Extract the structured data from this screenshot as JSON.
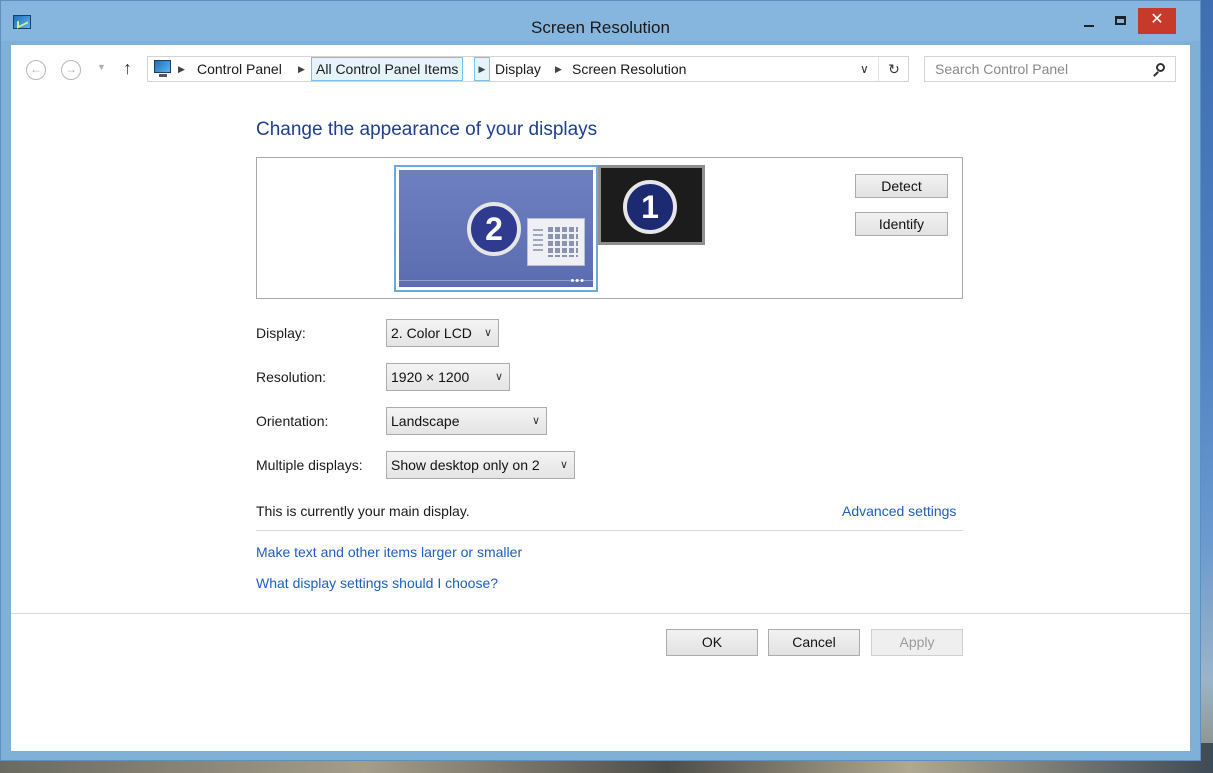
{
  "window": {
    "title": "Screen Resolution",
    "close_glyph": "✕"
  },
  "nav": {
    "breadcrumbs": [
      "Control Panel",
      "All Control Panel Items",
      "Display",
      "Screen Resolution"
    ],
    "search_placeholder": "Search Control Panel",
    "icons": [
      "back-icon",
      "forward-icon",
      "recent-locations-icon",
      "up-icon",
      "control-panel-icon",
      "address-dropdown-icon",
      "refresh-icon",
      "search-icon"
    ]
  },
  "main": {
    "heading": "Change the appearance of your displays",
    "monitors": [
      {
        "number": "2",
        "selected": true
      },
      {
        "number": "1",
        "selected": false
      }
    ],
    "detect_label": "Detect",
    "identify_label": "Identify",
    "fields": {
      "display": {
        "label": "Display:",
        "value": "2. Color LCD"
      },
      "resolution": {
        "label": "Resolution:",
        "value": "1920 × 1200"
      },
      "orientation": {
        "label": "Orientation:",
        "value": "Landscape"
      },
      "multiple": {
        "label": "Multiple displays:",
        "value": "Show desktop only on 2"
      }
    },
    "main_display_text": "This is currently your main display.",
    "advanced_link": "Advanced settings",
    "text_size_link": "Make text and other items larger or smaller",
    "help_link": "What display settings should I choose?"
  },
  "footer": {
    "ok": "OK",
    "cancel": "Cancel",
    "apply": "Apply",
    "apply_enabled": false
  },
  "colors": {
    "title_bar": "#86b6de",
    "close_button": "#c7392b",
    "heading": "#1e3f8f",
    "link": "#1e5fbf",
    "selected_monitor": "#5b6cb0"
  }
}
